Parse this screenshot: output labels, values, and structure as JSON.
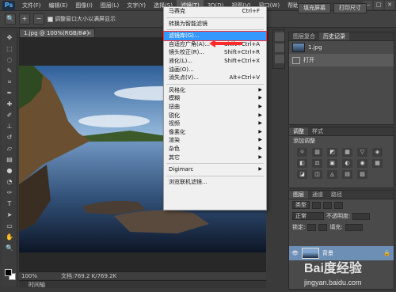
{
  "menubar": {
    "logo": "Ps",
    "items": [
      "文件(F)",
      "编辑(E)",
      "图像(I)",
      "图层(L)",
      "文字(Y)",
      "选择(S)",
      "滤镜(T)",
      "3D(D)",
      "视图(V)",
      "窗口(W)",
      "帮助(H)"
    ],
    "active_index": 6,
    "window_controls": [
      "—",
      "□",
      "✕"
    ]
  },
  "options_bar": {
    "tool_icon": "zoom-icon",
    "zoom_in": "+",
    "zoom_out": "−",
    "resize_window_label": "调整窗口大小以满屏显示",
    "buttons": [
      "填充屏幕",
      "打印尺寸"
    ]
  },
  "document": {
    "tab_label": "1.jpg @ 100%(RGB/8#)",
    "zoom": "100%",
    "doc_info": "文档:769.2 K/769.2K",
    "timeline_label": "时间轴"
  },
  "filter_menu": {
    "items": [
      {
        "label": "马赛克",
        "shortcut": "Ctrl+F",
        "state": "normal"
      },
      {
        "sep": true
      },
      {
        "label": "转换为智能滤镜",
        "state": "normal"
      },
      {
        "sep": true
      },
      {
        "label": "滤镜库(G)...",
        "state": "highlighted"
      },
      {
        "label": "自适应广角(A)...",
        "shortcut": "Shift+Ctrl+A",
        "state": "normal"
      },
      {
        "label": "镜头校正(R)...",
        "shortcut": "Shift+Ctrl+R",
        "state": "normal"
      },
      {
        "label": "液化(L)...",
        "shortcut": "Shift+Ctrl+X",
        "state": "normal"
      },
      {
        "label": "油画(O)...",
        "state": "normal"
      },
      {
        "label": "消失点(V)...",
        "shortcut": "Alt+Ctrl+V",
        "state": "normal"
      },
      {
        "sep": true
      },
      {
        "label": "风格化",
        "submenu": true
      },
      {
        "label": "模糊",
        "submenu": true
      },
      {
        "label": "扭曲",
        "submenu": true
      },
      {
        "label": "锐化",
        "submenu": true
      },
      {
        "label": "视频",
        "submenu": true
      },
      {
        "label": "像素化",
        "submenu": true
      },
      {
        "label": "渲染",
        "submenu": true
      },
      {
        "label": "杂色",
        "submenu": true
      },
      {
        "label": "其它",
        "submenu": true
      },
      {
        "sep": true
      },
      {
        "label": "Digimarc",
        "submenu": true
      },
      {
        "sep": true
      },
      {
        "label": "浏览联机滤镜...",
        "state": "normal"
      }
    ]
  },
  "history_panel": {
    "tabs": [
      "图层复合",
      "历史记录"
    ],
    "active_tab": 1,
    "items": [
      {
        "label": "1.jpg",
        "kind": "snapshot"
      },
      {
        "label": "打开",
        "kind": "step"
      }
    ]
  },
  "adjustments_panel": {
    "tabs": [
      "调整",
      "样式"
    ],
    "title": "添加调整",
    "icons": [
      "☼",
      "▥",
      "◩",
      "▦",
      "▽",
      "◈",
      "◧",
      "⚖",
      "▣",
      "◐",
      "◉",
      "▦",
      "◪",
      "◫",
      "◬",
      "▤",
      "▨"
    ]
  },
  "layers_panel": {
    "tabs": [
      "图层",
      "通道",
      "路径"
    ],
    "kind_label": "类型",
    "blend_mode": "正常",
    "opacity_label": "不透明度:",
    "lock_label": "锁定:",
    "fill_label": "填充:",
    "layer_name": "背景"
  },
  "watermark": {
    "text": "Bai度经验",
    "url": "jingyan.baidu.com"
  },
  "colors": {
    "highlight": "#3399ff",
    "annotation_red": "#ff2a2a",
    "layer_selected": "#6e8fb5"
  }
}
